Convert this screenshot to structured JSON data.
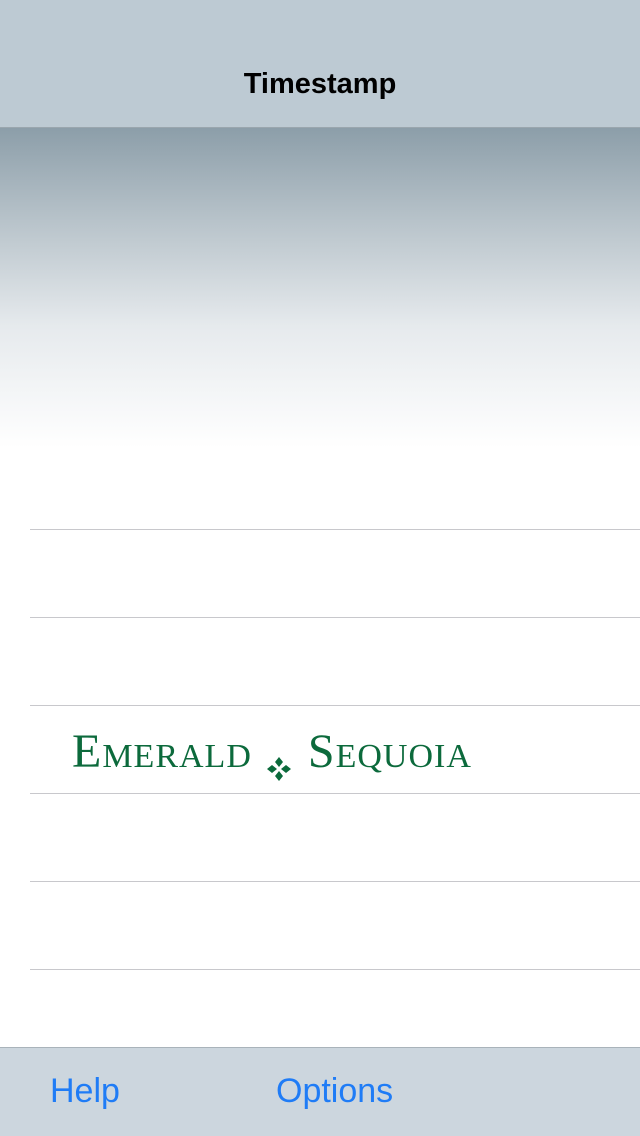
{
  "nav": {
    "title": "Timestamp"
  },
  "brand": {
    "left_word": "Emerald",
    "right_word": "Sequoia",
    "color": "#0c6a3c"
  },
  "toolbar": {
    "help_label": "Help",
    "options_label": "Options",
    "tint_color": "#1f7cf6"
  },
  "colors": {
    "nav_background": "#bdcad3",
    "toolbar_background": "#ccd6de",
    "separator": "#c8c8cc"
  }
}
